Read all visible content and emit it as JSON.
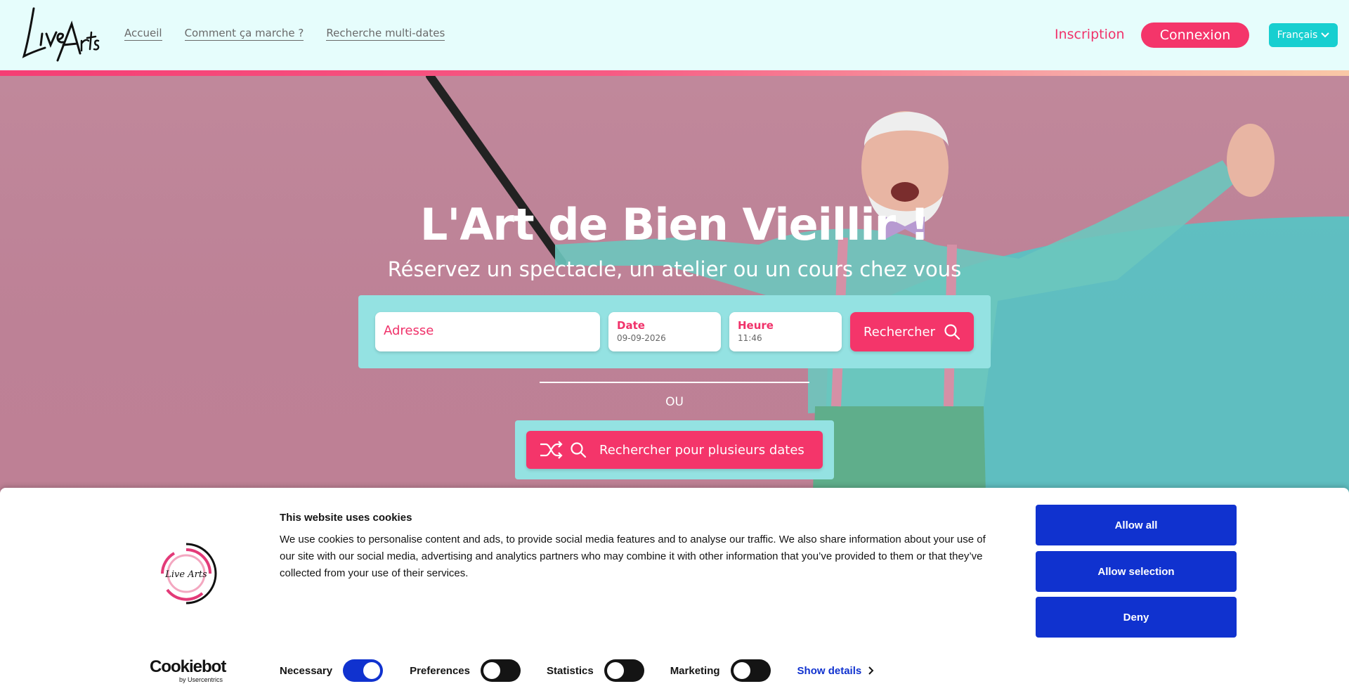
{
  "header": {
    "logo_text": "Live Arts",
    "nav": [
      {
        "label": "Accueil"
      },
      {
        "label": "Comment ça marche ?"
      },
      {
        "label": "Recherche multi-dates"
      }
    ],
    "inscription": "Inscription",
    "connexion": "Connexion",
    "language": "Français"
  },
  "hero": {
    "title": "L'Art de Bien Vieillir !",
    "subtitle": "Réservez un spectacle, un atelier ou un cours chez vous",
    "search": {
      "address_placeholder": "Adresse",
      "date_label": "Date",
      "date_value": "09-09-2026",
      "time_label": "Heure",
      "time_value": "11:46",
      "button": "Rechercher"
    },
    "or": "OU",
    "multi_button": "Rechercher pour plusieurs dates"
  },
  "cookie": {
    "title": "This website uses cookies",
    "text": "We use cookies to personalise content and ads, to provide social media features and to analyse our traffic. We also share information about your use of our site with our social media, advertising and analytics partners who may combine it with other information that you’ve provided to them or that they’ve collected from your use of their services.",
    "allow_all": "Allow all",
    "allow_selection": "Allow selection",
    "deny": "Deny",
    "toggles": [
      {
        "label": "Necessary",
        "on": true
      },
      {
        "label": "Preferences",
        "on": false
      },
      {
        "label": "Statistics",
        "on": false
      },
      {
        "label": "Marketing",
        "on": false
      }
    ],
    "show_details": "Show details",
    "brand": "Cookiebot",
    "brand_by": "by Usercentrics"
  },
  "colors": {
    "brand_pink": "#f4356a",
    "brand_teal": "#17cfd0",
    "cookie_blue": "#1032cf"
  }
}
